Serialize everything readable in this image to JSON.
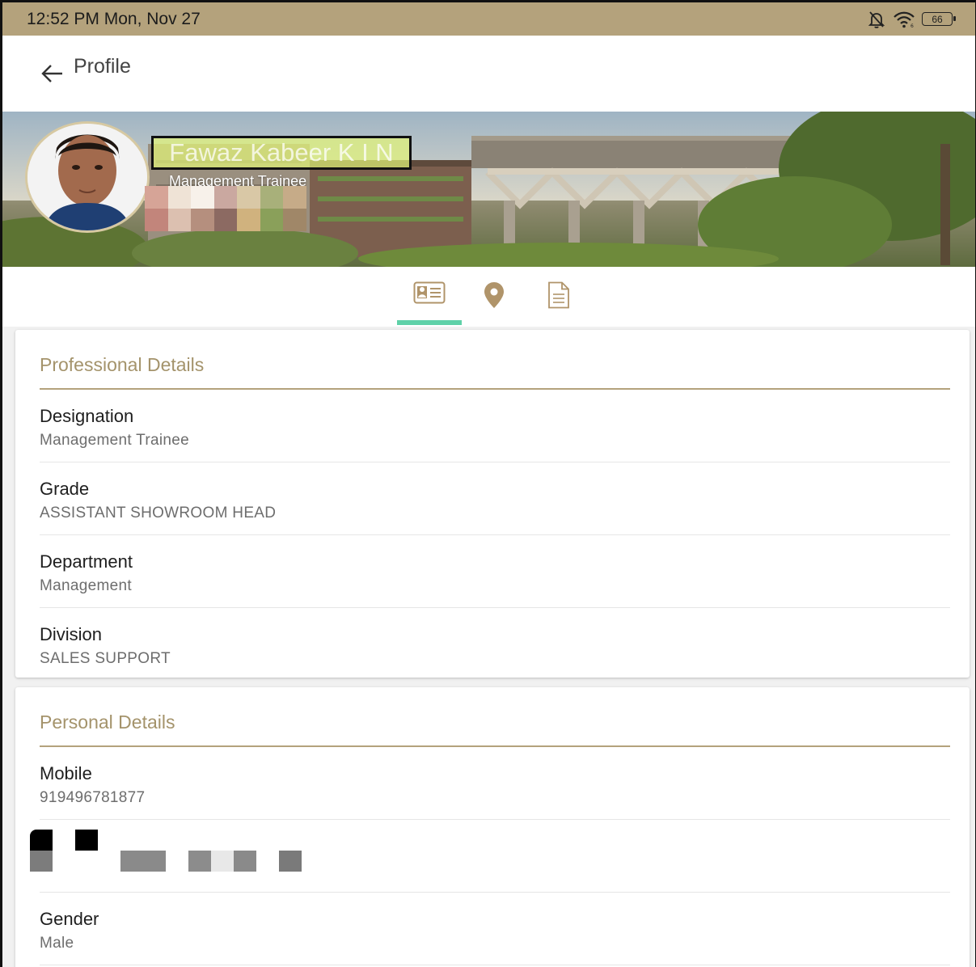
{
  "status_bar": {
    "time": "12:52 PM Mon, Nov 27",
    "battery": "66",
    "icons": [
      "bell-off-icon",
      "wifi-icon",
      "battery-icon"
    ]
  },
  "app_bar": {
    "title": "Profile",
    "back_icon": "arrow-left-icon"
  },
  "profile": {
    "name": "Fawaz Kabeer K I N",
    "role": "Management Trainee"
  },
  "tabs": [
    {
      "name": "id-card-icon",
      "selected": true
    },
    {
      "name": "location-pin-icon",
      "selected": false
    },
    {
      "name": "document-icon",
      "selected": false
    }
  ],
  "professional": {
    "title": "Professional Details",
    "fields": [
      {
        "label": "Designation",
        "value": "Management Trainee"
      },
      {
        "label": "Grade",
        "value": "ASSISTANT SHOWROOM HEAD"
      },
      {
        "label": "Department",
        "value": "Management"
      },
      {
        "label": "Division",
        "value": "SALES SUPPORT"
      }
    ]
  },
  "personal": {
    "title": "Personal Details",
    "fields": [
      {
        "label": "Mobile",
        "value": "919496781877"
      },
      {
        "label": "Gender",
        "value": "Male"
      }
    ]
  },
  "colors": {
    "status_bar": "#b4a27c",
    "accent_gold": "#a4936b",
    "tab_indicator": "#5fd1a8",
    "icon_brown": "#b0946a"
  }
}
